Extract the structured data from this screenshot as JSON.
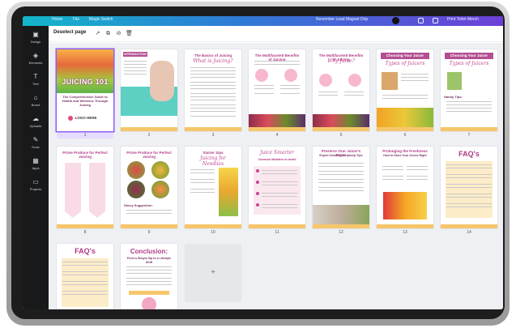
{
  "topbar": {
    "items": [
      "Home",
      "File",
      "Magic Switch"
    ],
    "doc_title": "November Lead Magnet Drip",
    "share_label": "Print Tshirt Merch"
  },
  "sidebar": {
    "items": [
      {
        "label": "Design",
        "icon": "design-icon"
      },
      {
        "label": "Elements",
        "icon": "elements-icon"
      },
      {
        "label": "Text",
        "icon": "text-icon"
      },
      {
        "label": "Brand",
        "icon": "brand-icon"
      },
      {
        "label": "Uploads",
        "icon": "uploads-icon"
      },
      {
        "label": "Draw",
        "icon": "draw-icon"
      },
      {
        "label": "Apps",
        "icon": "apps-icon"
      },
      {
        "label": "Projects",
        "icon": "projects-icon"
      }
    ]
  },
  "toolbar": {
    "deselect_label": "Deselect page"
  },
  "pages": [
    {
      "num": "1",
      "title": "JUICING 101",
      "subtitle": "The Comprehensive Guide to Health and Wellness Through Juicing",
      "logo": "LOGO HERE"
    },
    {
      "num": "2",
      "title": "INTRODUCTION"
    },
    {
      "num": "3",
      "title": "The Basics of Juicing",
      "subtitle": "What is Juicing?"
    },
    {
      "num": "4",
      "title": "The Multifaceted Benefits of Juicing"
    },
    {
      "num": "5",
      "title": "The Multifaceted Benefits of Juicing",
      "subtitle": "Why Juice?"
    },
    {
      "num": "6",
      "title": "Choosing Your Juicer",
      "subtitle": "Types of Juicers"
    },
    {
      "num": "7",
      "title": "Choosing Your Juicer",
      "subtitle": "Types of Juicers",
      "hint": "Handy Tips:"
    },
    {
      "num": "8",
      "title": "Prime Produce for Perfect Juicing"
    },
    {
      "num": "9",
      "title": "Prime Produce for Perfect Juicing",
      "hint": "Savvy Suggestion:"
    },
    {
      "num": "10",
      "title": "Starter Sips",
      "subtitle": "Juicing for Newbies"
    },
    {
      "num": "11",
      "title": "Juice Smarter",
      "subtitle": "Common Mistakes to Avoid"
    },
    {
      "num": "12",
      "title": "Preserve Your Juicer's Prime",
      "subtitle": "Expert Cleaning & Upkeep Tips"
    },
    {
      "num": "13",
      "title": "Prolonging the Freshness",
      "subtitle": "How to Store Your Juices Right"
    },
    {
      "num": "14",
      "title": "FAQ's"
    },
    {
      "num": "",
      "title": "FAQ's"
    },
    {
      "num": "",
      "title": "Conclusion:",
      "subtitle": "From a Simple Sip to a Lifestyle Shift"
    }
  ],
  "add_page_label": "+"
}
